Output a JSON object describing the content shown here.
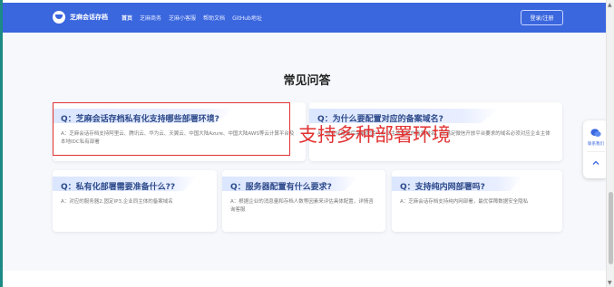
{
  "navbar": {
    "brand": "芝麻会话存档",
    "items": [
      {
        "label": "首页",
        "active": true
      },
      {
        "label": "芝麻商务",
        "active": false
      },
      {
        "label": "芝麻小客服",
        "active": false
      },
      {
        "label": "帮助文档",
        "active": false
      },
      {
        "label": "GitHub地址",
        "active": false
      }
    ],
    "login": "登录/注册"
  },
  "faq": {
    "title": "常见问答",
    "cards": [
      {
        "q": "Q：芝麻会话存档私有化支持哪些部署环境?",
        "a": "A：芝麻会话存档支持阿里云、腾讯云、华为云、天翼云、中国大陆Azure、中国大陆AWS等云计算平台及本地IDC私有部署"
      },
      {
        "q": "Q：为什么要配置对应的备案域名?",
        "a": "A：私有化部署后需要配置与企业主体对应的备案域名，以满足微信开放平台要求的域名必须对应企业主体"
      },
      {
        "q": "Q：私有化部署需要准备什么??",
        "a": "A：对应的服务器2,固定IP3,企业同主体的备案域名"
      },
      {
        "q": "Q：服务器配置有什么要求?",
        "a": "A：根据企业的消息量和存档人数等因素来评估具体配置，详情咨询客服"
      },
      {
        "q": "Q：支持纯内网部署吗?",
        "a": "A：芝麻会话存档支持纯内网部署，最优保障数据安全隐私"
      }
    ]
  },
  "annotation": {
    "text": "支持多种部署环境",
    "color": "#e23232"
  },
  "float_widget": {
    "chat_label": "联系我们"
  },
  "colors": {
    "brand": "#3a66de",
    "question": "#2d4a8a",
    "annotation": "#e23232"
  }
}
